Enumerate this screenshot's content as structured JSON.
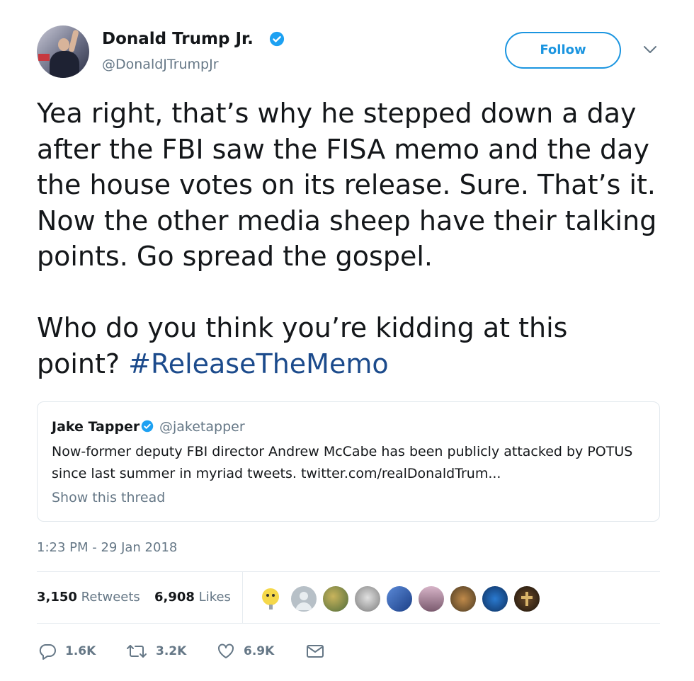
{
  "author": {
    "name": "Donald Trump Jr.",
    "handle": "@DonaldJTrumpJr",
    "verified": true
  },
  "follow_button": {
    "label": "Follow"
  },
  "menu": {
    "icon": "chevron-down-icon"
  },
  "tweet": {
    "text": "Yea right, that’s why he stepped down a day\nafter the FBI saw the FISA memo and the day\nthe house votes on its release. Sure. That’s it.\nNow the other media sheep have their talking\npoints. Go spread the gospel.\n\nWho do you think you’re kidding at this\npoint? ",
    "hashtag": "#ReleaseTheMemo"
  },
  "quoted_tweet": {
    "name": "Jake Tapper",
    "handle": "@jaketapper",
    "verified": true,
    "text": "Now-former deputy FBI director Andrew McCabe has been publicly attacked by POTUS since last summer in myriad tweets. twitter.com/realDonaldTrum...",
    "show_thread": "Show this thread"
  },
  "timestamp": "1:23 PM - 29 Jan 2018",
  "stats": {
    "retweets_count": "3,150",
    "retweets_label": "Retweets",
    "likes_count": "6,908",
    "likes_label": "Likes"
  },
  "likers": [
    {
      "icon": "emoji-avatar",
      "color": "#f5d84a"
    },
    {
      "icon": "default-avatar",
      "color": "#b7c0c7"
    },
    {
      "icon": "photo-avatar",
      "color": "#7a8c5a"
    },
    {
      "icon": "photo-avatar",
      "color": "#9a9a9a"
    },
    {
      "icon": "photo-avatar",
      "color": "#2d58a8"
    },
    {
      "icon": "photo-avatar",
      "color": "#b48aa6"
    },
    {
      "icon": "photo-avatar",
      "color": "#8c6a3b"
    },
    {
      "icon": "photo-avatar",
      "color": "#1f5fa6"
    },
    {
      "icon": "photo-avatar",
      "color": "#3b2a1f"
    }
  ],
  "actions": {
    "reply": "1.6K",
    "retweet": "3.2K",
    "like": "6.9K"
  },
  "colors": {
    "accent": "#1b95e0",
    "hashtag": "#1c4b8c",
    "secondary_text": "#657786",
    "border": "#e1e8ed"
  }
}
